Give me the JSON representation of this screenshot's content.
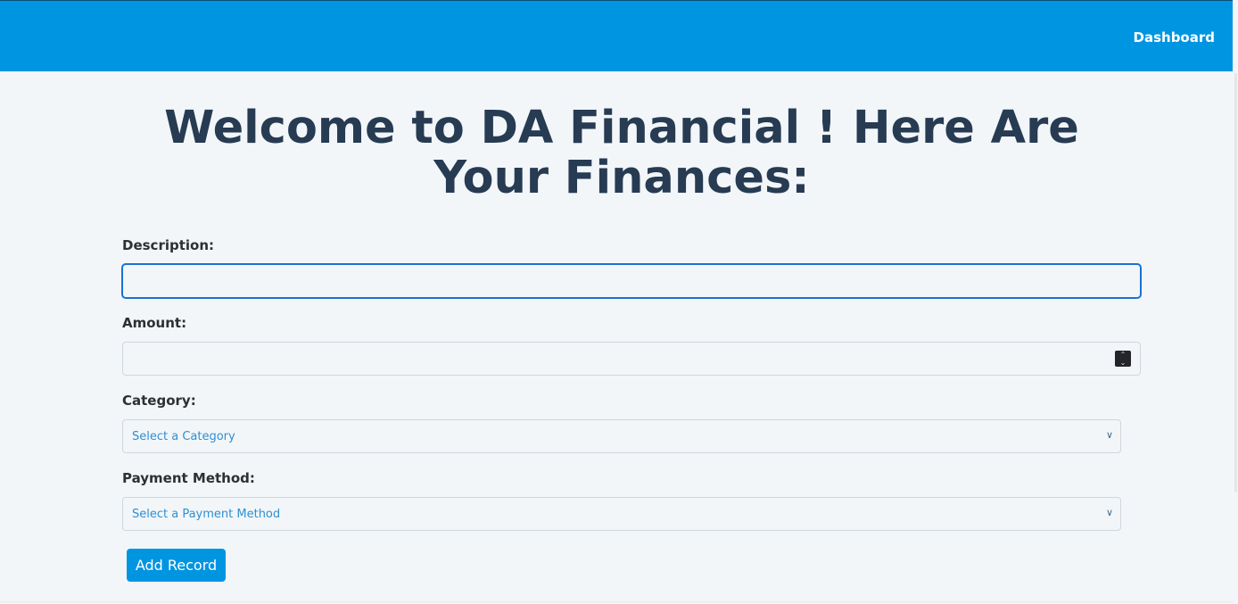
{
  "nav": {
    "dashboard_label": "Dashboard"
  },
  "page": {
    "title": "Welcome to DA Financial ! Here Are Your Finances:"
  },
  "form": {
    "description": {
      "label": "Description:",
      "value": "",
      "placeholder": ""
    },
    "amount": {
      "label": "Amount:",
      "value": "",
      "placeholder": ""
    },
    "category": {
      "label": "Category:",
      "selected": "Select a Category"
    },
    "payment_method": {
      "label": "Payment Method:",
      "selected": "Select a Payment Method"
    },
    "submit_label": "Add Record"
  },
  "icons": {
    "spinner": "number-spinner-icon",
    "dropdown": "chevron-down-icon"
  },
  "colors": {
    "brand": "#0095e1",
    "title": "#273b52",
    "select_text": "#2f8fd1",
    "focus_border": "#1a70d6",
    "background": "#f2f6f9"
  }
}
